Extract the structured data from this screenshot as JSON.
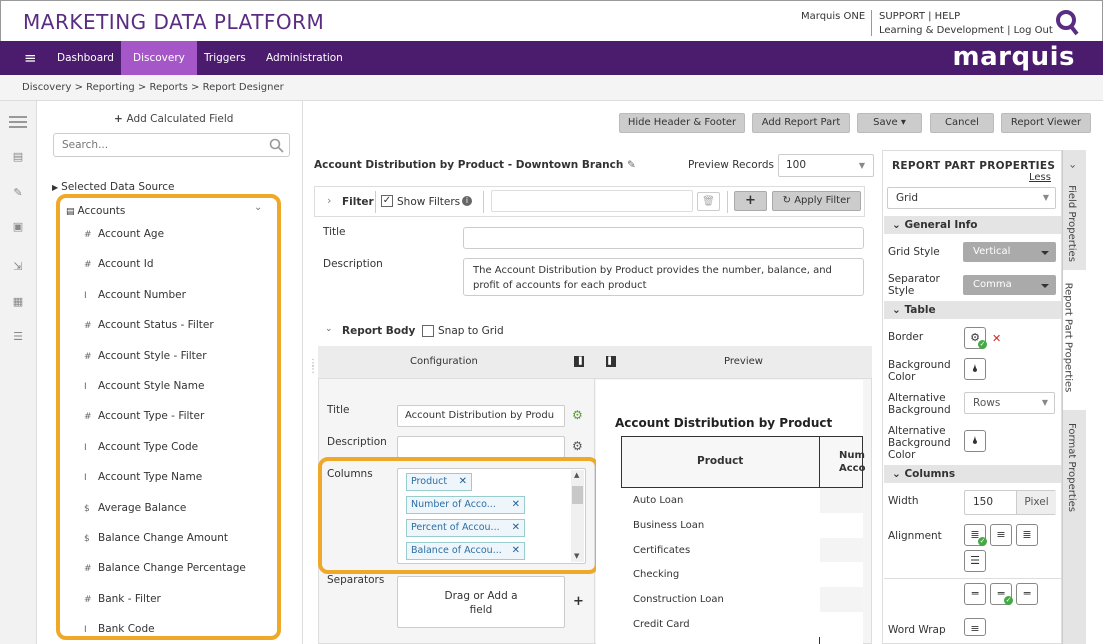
{
  "header": {
    "brand": "MARKETING DATA PLATFORM",
    "user": "Marquis ONE",
    "links_line1": "SUPPORT | HELP",
    "links_line2": "Learning & Development | Log Out"
  },
  "nav": {
    "menu_icon": "≡",
    "items": [
      "Dashboard",
      "Discovery",
      "Triggers",
      "Administration"
    ],
    "logo": "marquis"
  },
  "breadcrumb": "Discovery  >  Reporting  >  Reports  >  Report Designer",
  "left": {
    "add_calc": "Add Calculated Field",
    "search_placeholder": "Search...",
    "source_label": "Selected Data Source",
    "source_name": "Accounts",
    "fields": [
      {
        "icon": "#",
        "label": "Account Age"
      },
      {
        "icon": "#",
        "label": "Account Id"
      },
      {
        "icon": "I",
        "label": "Account Number"
      },
      {
        "icon": "#",
        "label": "Account Status - Filter"
      },
      {
        "icon": "#",
        "label": "Account Style - Filter"
      },
      {
        "icon": "I",
        "label": "Account Style Name"
      },
      {
        "icon": "#",
        "label": "Account Type - Filter"
      },
      {
        "icon": "I",
        "label": "Account Type Code"
      },
      {
        "icon": "I",
        "label": "Account Type Name"
      },
      {
        "icon": "$",
        "label": "Average Balance"
      },
      {
        "icon": "$",
        "label": "Balance Change Amount"
      },
      {
        "icon": "#",
        "label": "Balance Change Percentage"
      },
      {
        "icon": "#",
        "label": "Bank - Filter"
      },
      {
        "icon": "I",
        "label": "Bank Code"
      }
    ]
  },
  "toolbar": {
    "hide_header_footer": "Hide Header & Footer",
    "add_report_part": "Add Report Part",
    "save": "Save ▾",
    "cancel": "Cancel",
    "report_viewer": "Report Viewer"
  },
  "report": {
    "title": "Account Distribution by Product - Downtown Branch",
    "preview_records_label": "Preview Records",
    "preview_records_value": "100",
    "filter_label": "Filter",
    "show_filters": "Show Filters",
    "apply_filter": "Apply Filter",
    "title_label": "Title",
    "description_label": "Description",
    "description_text": "The Account Distribution by Product provides the number, balance, and profit of accounts for each product",
    "report_body": "Report Body",
    "snap_to_grid": "Snap to Grid"
  },
  "config": {
    "configuration": "Configuration",
    "preview": "Preview",
    "title_label": "Title",
    "title_value": "Account Distribution by Produ",
    "description_label": "Description",
    "columns_label": "Columns",
    "columns": [
      "Product",
      "Number of Acco...",
      "Percent of Accou...",
      "Balance of Accou..."
    ],
    "separators_label": "Separators",
    "drag_add": "Drag or Add a field"
  },
  "preview": {
    "title": "Account Distribution by Product",
    "col1": "Product",
    "col2": "Num Acco",
    "rows": [
      "Auto Loan",
      "Business Loan",
      "Certificates",
      "Checking",
      "Construction Loan",
      "Credit Card"
    ]
  },
  "props": {
    "header": "REPORT PART PROPERTIES",
    "less": "Less",
    "type": "Grid",
    "general_info": "General Info",
    "grid_style_label": "Grid Style",
    "grid_style_value": "Vertical",
    "separator_label": "Separator Style",
    "separator_value": "Comma",
    "table": "Table",
    "border": "Border",
    "bg_color": "Background Color",
    "alt_bg": "Alternative Background",
    "alt_bg_value": "Rows",
    "alt_bg_color": "Alternative Background Color",
    "columns": "Columns",
    "width": "Width",
    "width_value": "150",
    "width_unit": "Pixel",
    "alignment": "Alignment",
    "word_wrap": "Word Wrap",
    "tabs": [
      "Field Properties",
      "Report Part Properties",
      "Format Properties"
    ]
  },
  "colors": {
    "brand_purple": "#5a2d82",
    "nav_bg": "#4b1b6e",
    "nav_active": "#a557c7",
    "highlight": "#f0a828"
  }
}
